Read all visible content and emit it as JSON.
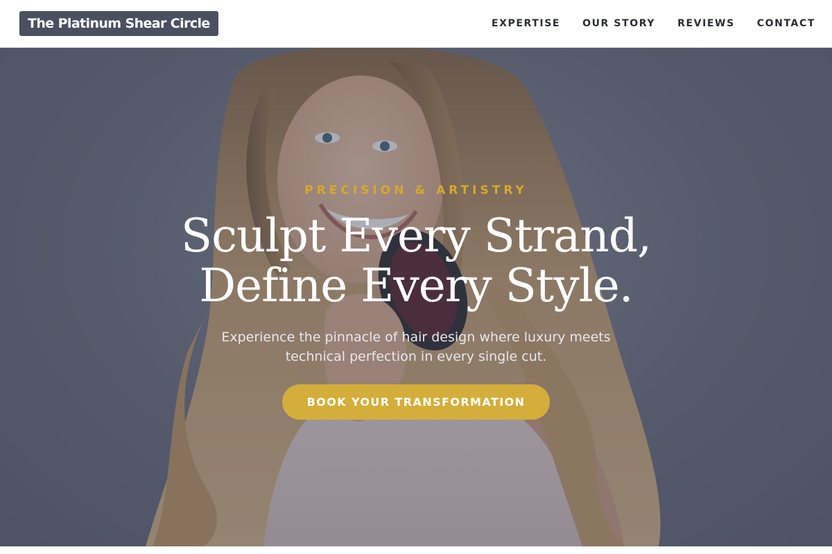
{
  "header": {
    "brand": "The Platinum Shear Circle",
    "nav": [
      "EXPERTISE",
      "OUR STORY",
      "REVIEWS",
      "CONTACT"
    ]
  },
  "hero": {
    "eyebrow": "PRECISION & ARTISTRY",
    "headline_line1": "Sculpt Every Strand,",
    "headline_line2": "Define Every Style.",
    "subtext": "Experience the pinnacle of hair design where luxury meets technical perfection in every single cut.",
    "cta": "BOOK YOUR TRANSFORMATION",
    "photo_subject": "smiling woman with long wavy blonde hair holding a round brush"
  },
  "colors": {
    "accent_gold": "#d4ae3a",
    "brand_bg": "#4a5060",
    "nav_text": "#2b2d33",
    "overlay": "#373c4e"
  }
}
